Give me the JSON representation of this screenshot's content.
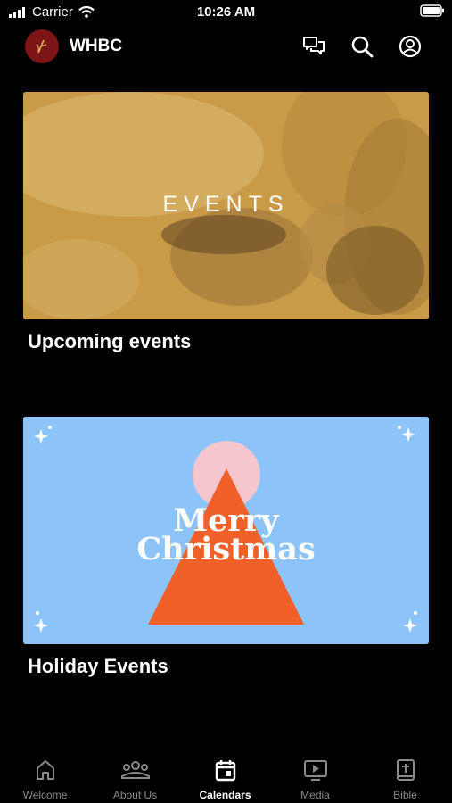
{
  "status": {
    "carrier": "Carrier",
    "time": "10:26 AM"
  },
  "app": {
    "title": "WHBC"
  },
  "cards": [
    {
      "image_text": "EVENTS",
      "title": "Upcoming events"
    },
    {
      "image_text_1": "Merry",
      "image_text_2": "Christmas",
      "title": "Holiday Events"
    }
  ],
  "tabs": [
    {
      "label": "Welcome",
      "icon": "home-icon"
    },
    {
      "label": "About Us",
      "icon": "people-icon"
    },
    {
      "label": "Calendars",
      "icon": "calendar-icon",
      "active": true
    },
    {
      "label": "Media",
      "icon": "media-play-icon"
    },
    {
      "label": "Bible",
      "icon": "bible-icon"
    }
  ],
  "colors": {
    "events_card": "#c99a48",
    "holiday_card": "#8cc4fa",
    "tree": "#f0612a",
    "sun": "#f6c6cf",
    "logo_bg": "#7d1416"
  }
}
